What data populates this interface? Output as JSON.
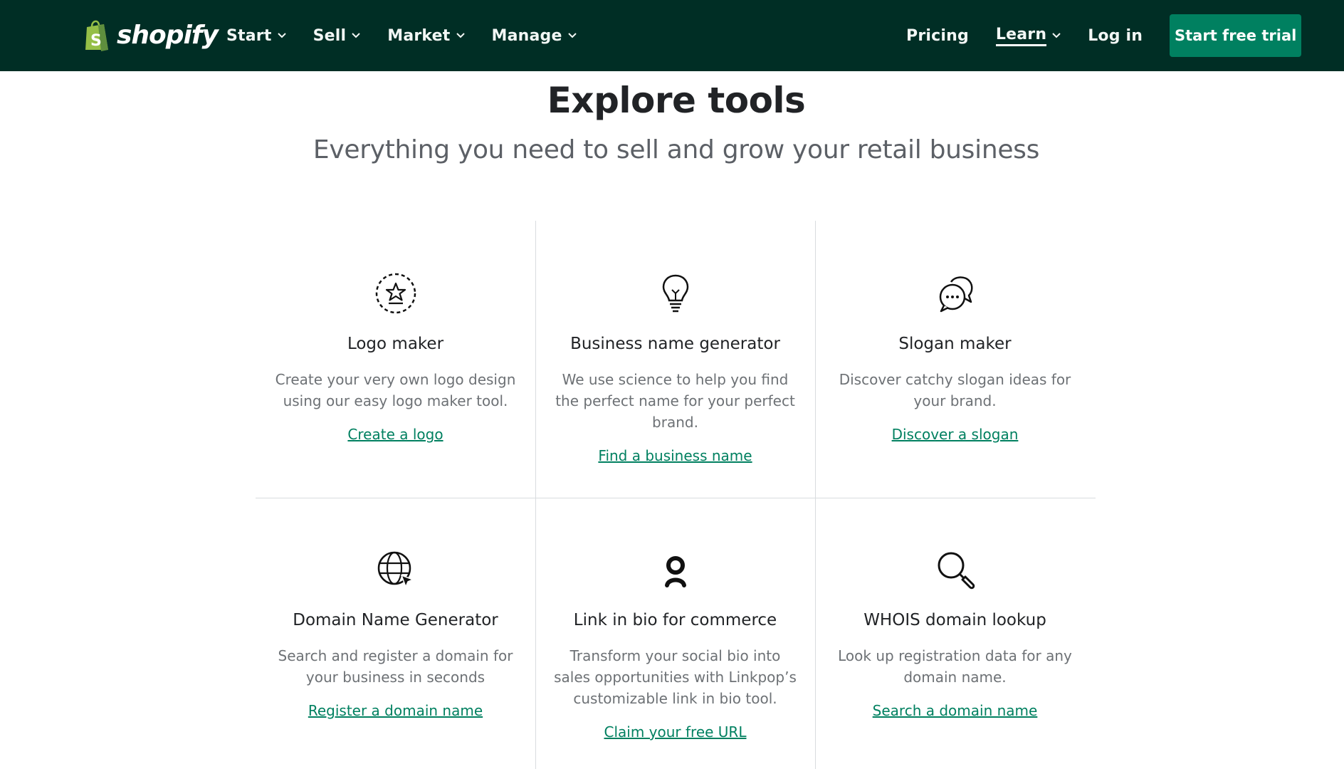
{
  "header": {
    "brand": "shopify",
    "nav_left": [
      "Start",
      "Sell",
      "Market",
      "Manage"
    ],
    "pricing": "Pricing",
    "learn": "Learn",
    "login": "Log in",
    "cta": "Start free trial"
  },
  "hero": {
    "title": "Explore tools",
    "subtitle": "Everything you need to sell and grow your retail business"
  },
  "tools": [
    {
      "icon": "star-badge-icon",
      "title": "Logo maker",
      "desc": "Create your very own logo design using our easy logo maker tool.",
      "link": "Create a logo"
    },
    {
      "icon": "lightbulb-icon",
      "title": "Business name generator",
      "desc": "We use science to help you find the perfect name for your perfect brand.",
      "link": "Find a business name"
    },
    {
      "icon": "chat-bubbles-icon",
      "title": "Slogan maker",
      "desc": "Discover catchy slogan ideas for your brand.",
      "link": "Discover a slogan"
    },
    {
      "icon": "globe-cursor-icon",
      "title": "Domain Name Generator",
      "desc": "Search and register a domain for your business in seconds",
      "link": "Register a domain name"
    },
    {
      "icon": "linkpop-icon",
      "title": "Link in bio for commerce",
      "desc": "Transform your social bio into sales opportunities with Linkpop’s customizable link in bio tool.",
      "link": "Claim your free URL"
    },
    {
      "icon": "magnifier-icon",
      "title": "WHOIS domain lookup",
      "desc": "Look up registration data for any domain name.",
      "link": "Search a domain name"
    }
  ],
  "colors": {
    "header_bg": "#002e25",
    "accent": "#008060",
    "brand_bag": "#95bf47"
  }
}
